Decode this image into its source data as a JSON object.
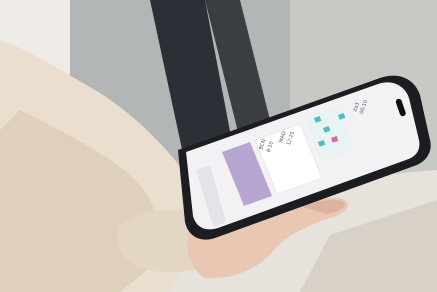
{
  "photo": {
    "subject": "hand-holding-smartphone",
    "colors": {
      "window_frame": "#2a2d33",
      "window_glass": "#9aa1a7",
      "wall": "#f0eeea",
      "sleeve": "#e8dccb",
      "skin": "#e7c6b2",
      "phone_case": "#1b1d21",
      "screen_bg": "#f4f1f6",
      "accent_purple": "#a58fc2",
      "accent_teal": "#4ebdc2",
      "accent_pink": "#d96aa1"
    }
  },
  "phone_screen": {
    "header_code": "2a3",
    "header_sub": "00:10",
    "card_left_code": "BCN",
    "card_left_time": "8:10",
    "card_right_code": "MAD",
    "card_right_time": "12:25",
    "footer_text": "",
    "url_bar_text": ""
  }
}
